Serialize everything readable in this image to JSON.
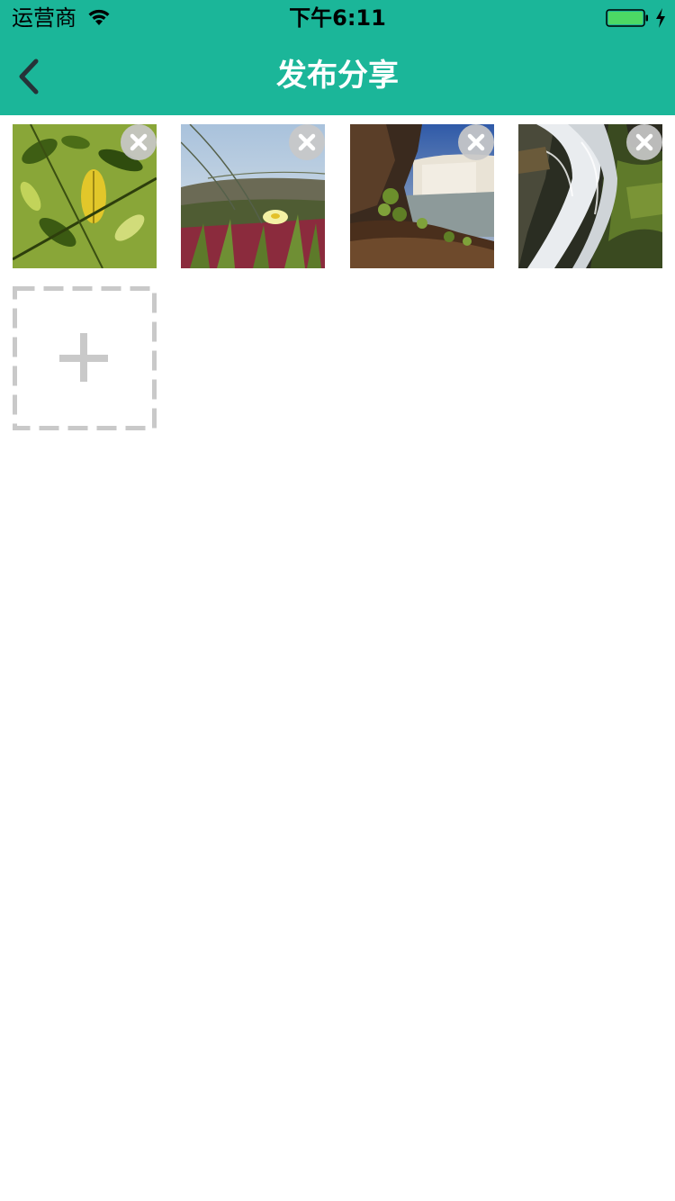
{
  "status_bar": {
    "carrier": "运营商",
    "time": "下午6:11",
    "battery_level": 1.0
  },
  "nav": {
    "title": "发布分享",
    "back_icon": "chevron-left-icon"
  },
  "colors": {
    "accent": "#1bb699",
    "remove_button_bg": "#c8c8c8",
    "add_border": "#c9c9c9",
    "battery_fill": "#4cd964"
  },
  "photos": [
    {
      "description_icon": "photo-leaves"
    },
    {
      "description_icon": "photo-flower"
    },
    {
      "description_icon": "photo-waterfall-cliff"
    },
    {
      "description_icon": "photo-waterfall-rocks"
    }
  ],
  "actions": {
    "remove_icon": "close-icon",
    "add_icon": "plus-icon"
  }
}
